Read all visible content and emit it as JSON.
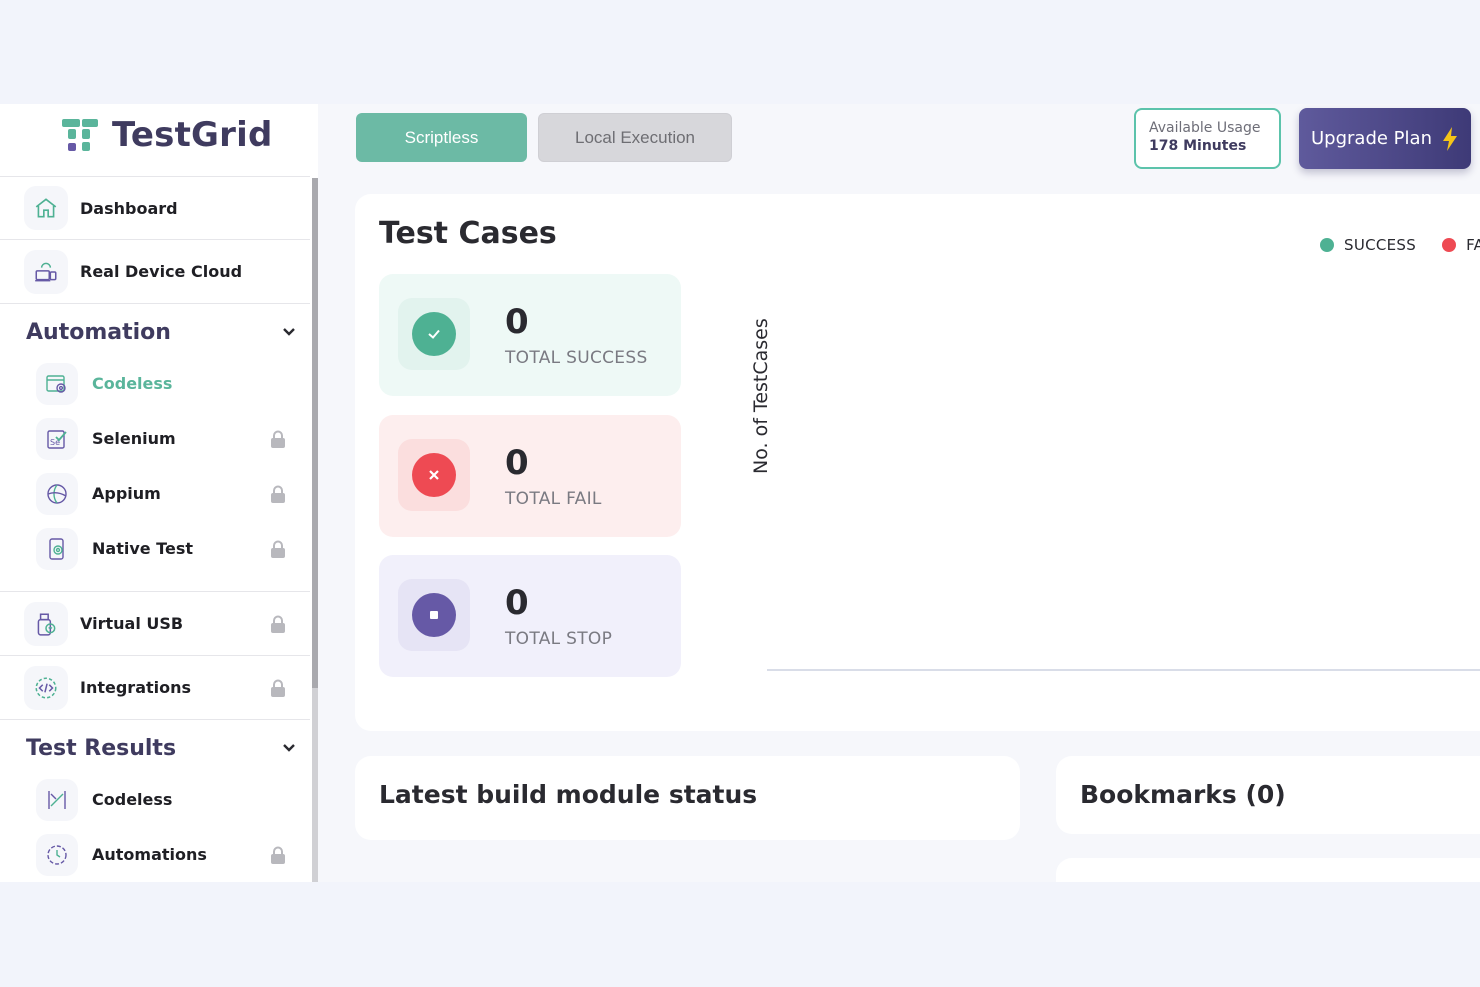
{
  "brand": {
    "name": "TestGrid"
  },
  "sidebar": {
    "top_items": [
      {
        "label": "Dashboard",
        "icon": "home-icon"
      },
      {
        "label": "Real Device Cloud",
        "icon": "device-cloud-icon"
      }
    ],
    "automation": {
      "title": "Automation",
      "items": [
        {
          "label": "Codeless",
          "icon": "codeless-icon",
          "active": true,
          "locked": false
        },
        {
          "label": "Selenium",
          "icon": "selenium-icon",
          "locked": true
        },
        {
          "label": "Appium",
          "icon": "appium-icon",
          "locked": true
        },
        {
          "label": "Native Test",
          "icon": "native-test-icon",
          "locked": true
        }
      ]
    },
    "mid_items": [
      {
        "label": "Virtual USB",
        "icon": "virtual-usb-icon",
        "locked": true
      },
      {
        "label": "Integrations",
        "icon": "integrations-icon",
        "locked": true
      }
    ],
    "test_results": {
      "title": "Test Results",
      "items": [
        {
          "label": "Codeless",
          "icon": "codeless-results-icon",
          "locked": false
        },
        {
          "label": "Automations",
          "icon": "automations-results-icon",
          "locked": true
        }
      ]
    }
  },
  "topbar": {
    "scriptless_label": "Scriptless",
    "local_label": "Local Execution",
    "usage_label": "Available Usage",
    "usage_value": "178 Minutes",
    "upgrade_label": "Upgrade Plan"
  },
  "test_cases": {
    "title": "Test Cases",
    "stats": [
      {
        "value": "0",
        "label": "TOTAL SUCCESS"
      },
      {
        "value": "0",
        "label": "TOTAL FAIL"
      },
      {
        "value": "0",
        "label": "TOTAL STOP"
      }
    ],
    "chart_ylabel": "No. of TestCases",
    "legend": [
      {
        "label": "SUCCESS",
        "color": "#4eb193"
      },
      {
        "label": "FA",
        "color": "#ee4a53"
      }
    ]
  },
  "build": {
    "title": "Latest build module status"
  },
  "bookmarks": {
    "title": "Bookmarks (0)"
  },
  "colors": {
    "accent": "#6cbaa5",
    "brand_dark": "#3f3b5f",
    "fail": "#ee4a53",
    "stop": "#6659a6"
  }
}
